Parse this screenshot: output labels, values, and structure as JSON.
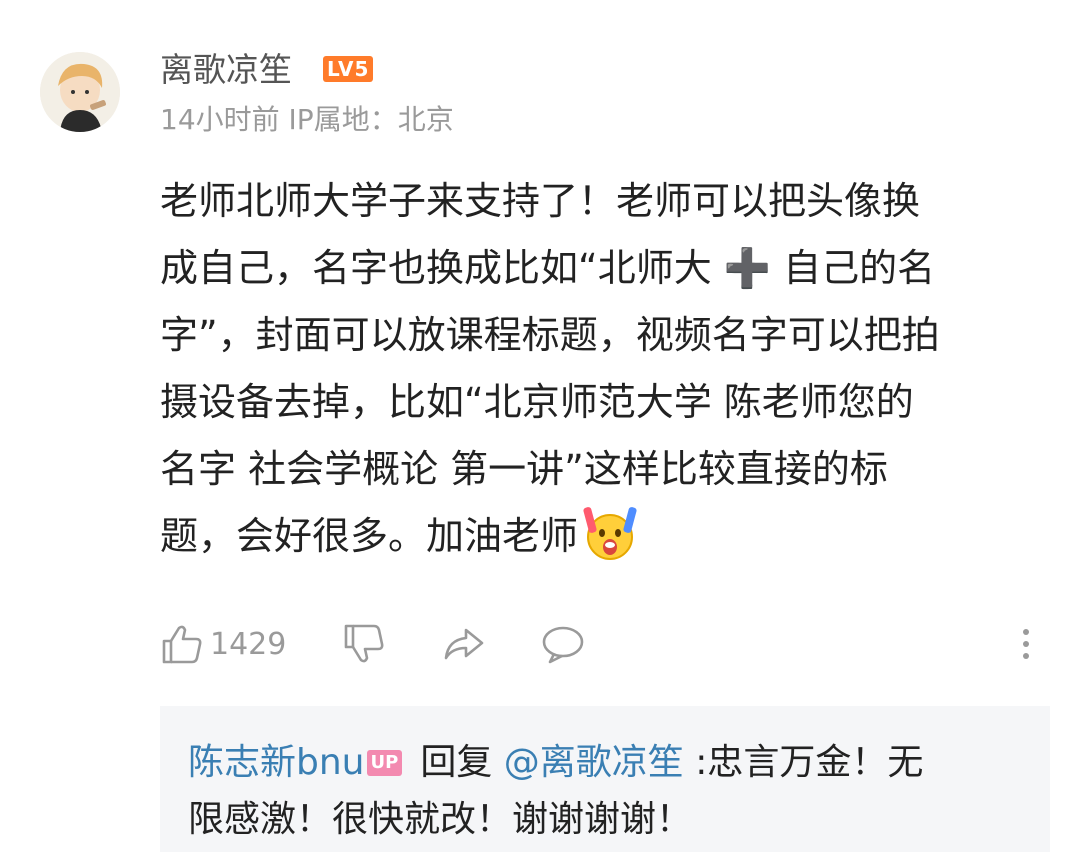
{
  "comment": {
    "username": "离歌凉笙",
    "level_badge": "LV5",
    "time_ago": "14小时前",
    "ip_location": "IP属地：北京",
    "body_lines": [
      "老师北师大学子来支持了！老师可以把头像换",
      "成自己，名字也换成比如“北师大 ➕ 自己的名",
      "字”，封面可以放课程标题，视频名字可以把拍",
      "摄设备去掉，比如“北京师范大学 陈老师您的",
      "名字 社会学概论 第一讲”这样比较直接的标",
      "题，会好很多。加油老师"
    ],
    "trailing_emoji": "emoji-cheering-with-glowsticks-icon",
    "like_count": "1429"
  },
  "reply": {
    "author": "陈志新bnu",
    "author_badge": "UP",
    "action_word": "回复",
    "mention": "@离歌凉笙",
    "text_line1": ":忠言万金！无",
    "text_line2": "限感激！很快就改！谢谢谢谢！"
  },
  "colors": {
    "link_blue": "#3a7fb3",
    "level_orange": "#ff7b2a",
    "up_pink": "#f38ab0",
    "meta_gray": "#9a9a9a"
  }
}
